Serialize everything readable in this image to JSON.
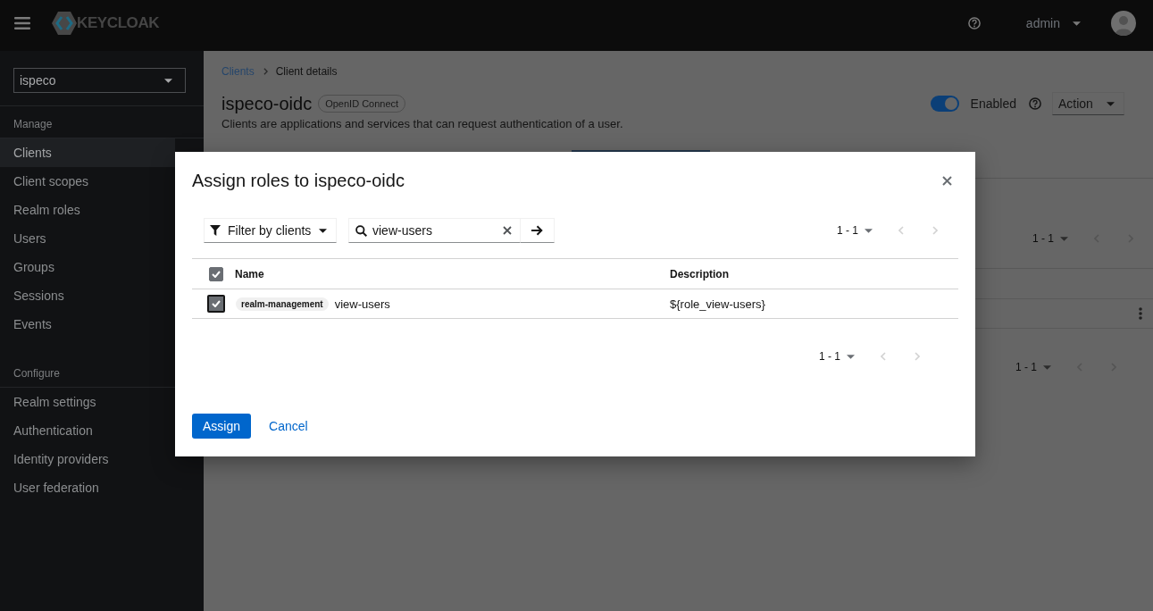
{
  "header": {
    "logo_text": "KEYCLOAK",
    "user": "admin"
  },
  "sidebar": {
    "realm": "ispeco",
    "sections": [
      {
        "title": "Manage",
        "items": [
          {
            "label": "Clients",
            "selected": true
          },
          {
            "label": "Client scopes",
            "selected": false
          },
          {
            "label": "Realm roles",
            "selected": false
          },
          {
            "label": "Users",
            "selected": false
          },
          {
            "label": "Groups",
            "selected": false
          },
          {
            "label": "Sessions",
            "selected": false
          },
          {
            "label": "Events",
            "selected": false
          }
        ]
      },
      {
        "title": "Configure",
        "items": [
          {
            "label": "Realm settings",
            "selected": false
          },
          {
            "label": "Authentication",
            "selected": false
          },
          {
            "label": "Identity providers",
            "selected": false
          },
          {
            "label": "User federation",
            "selected": false
          }
        ]
      }
    ]
  },
  "page": {
    "breadcrumbs": [
      {
        "label": "Clients",
        "kind": "link"
      },
      {
        "label": "Client details",
        "kind": "current"
      }
    ],
    "title": "ispeco-oidc",
    "badge": "OpenID Connect",
    "description": "Clients are applications and services that can request authentication of a user.",
    "enabled": {
      "label": "Enabled",
      "on": true
    },
    "action": "Action",
    "paginations": [
      {
        "range": "1 - 1",
        "prev_disabled": true,
        "next_disabled": true
      },
      {
        "range": "1 - 1",
        "prev_disabled": true,
        "next_disabled": true
      }
    ]
  },
  "modal": {
    "title": "Assign roles to ispeco-oidc",
    "filter": "Filter by clients",
    "search": {
      "value": "view-users"
    },
    "pagination_top": {
      "range": "1 - 1",
      "prev_disabled": true,
      "next_disabled": true
    },
    "table": {
      "columns": [
        "Name",
        "Description"
      ],
      "all_checked": true,
      "rows": [
        {
          "checked": true,
          "focused": true,
          "client": "realm-management",
          "name": "view-users",
          "description": "${role_view-users}"
        }
      ]
    },
    "pagination_bottom": {
      "range": "1 - 1",
      "prev_disabled": true,
      "next_disabled": true
    },
    "buttons": [
      {
        "label": "Assign",
        "kind": "primary"
      },
      {
        "label": "Cancel",
        "kind": "link"
      }
    ]
  }
}
